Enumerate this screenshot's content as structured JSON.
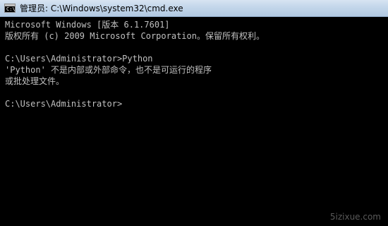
{
  "window": {
    "title": "管理员: C:\\Windows\\system32\\cmd.exe",
    "icon": "cmd-console-icon",
    "icon_prompt": "C:\\"
  },
  "console": {
    "lines": [
      "Microsoft Windows [版本 6.1.7601]",
      "版权所有 (c) 2009 Microsoft Corporation。保留所有权利。",
      "",
      "C:\\Users\\Administrator>Python",
      "'Python' 不是内部或外部命令，也不是可运行的程序",
      "或批处理文件。",
      "",
      "C:\\Users\\Administrator>"
    ],
    "text_color": "#c0c0c0",
    "background_color": "#000000"
  },
  "watermark": "5izixue.com"
}
